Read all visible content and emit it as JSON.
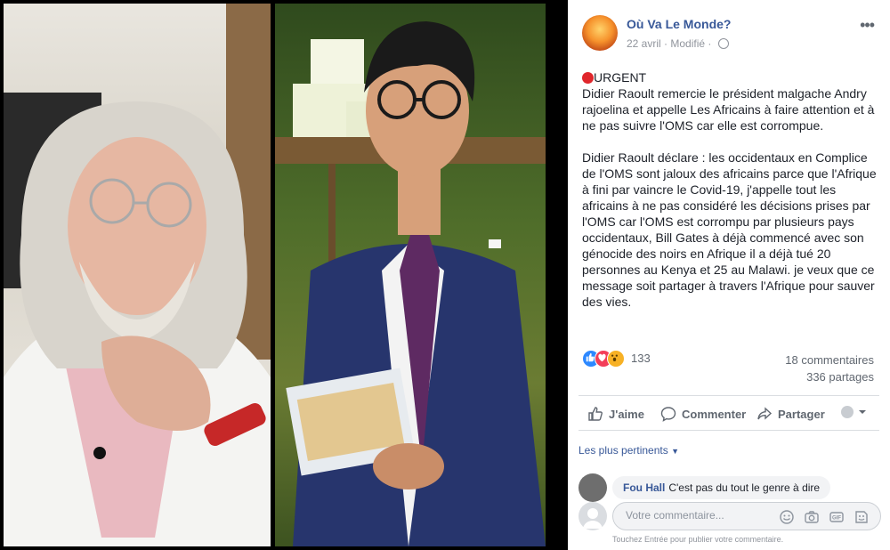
{
  "post": {
    "page_name": "Où Va Le Monde?",
    "date": "22 avril",
    "edited_label": "Modifié",
    "more_label": "•••",
    "text": {
      "headline": "URGENT",
      "paragraph1": "Didier Raoult remercie le président malgache Andry rajoelina et appelle Les Africains à faire attention et à ne pas suivre l'OMS car elle est corrompue.",
      "paragraph2": "Didier Raoult déclare : les occidentaux en Complice de l'OMS sont jaloux des africains parce que l'Afrique à fini par vaincre le Covid-19, j'appelle tout les africains à ne pas considéré les décisions prises par l'OMS car l'OMS est corrompu par plusieurs pays occidentaux, Bill Gates à déjà commencé avec son génocide des noirs en Afrique il a déjà tué 20 personnes au Kenya et 25 au Malawi. je veux que ce message soit partager à travers l'Afrique pour sauver des vies."
    },
    "reactions": {
      "count": "133",
      "icons": [
        "like-icon",
        "love-icon",
        "wow-icon"
      ]
    },
    "comments_count": "18 commentaires",
    "shares_count": "336 partages",
    "actions": {
      "like": "J'aime",
      "comment": "Commenter",
      "share": "Partager"
    },
    "filter_label": "Les plus pertinents",
    "comment": {
      "author": "Fou Hall",
      "text": "C'est pas du tout le genre à dire"
    },
    "input": {
      "placeholder": "Votre commentaire...",
      "hint": "Touchez Entrée pour publier votre commentaire."
    }
  },
  "colors": {
    "link": "#385898",
    "reaction_like": "#2d88ff",
    "reaction_love": "#f33e58",
    "reaction_wow": "#f7b125",
    "urgent_dot": "#e0262b"
  }
}
